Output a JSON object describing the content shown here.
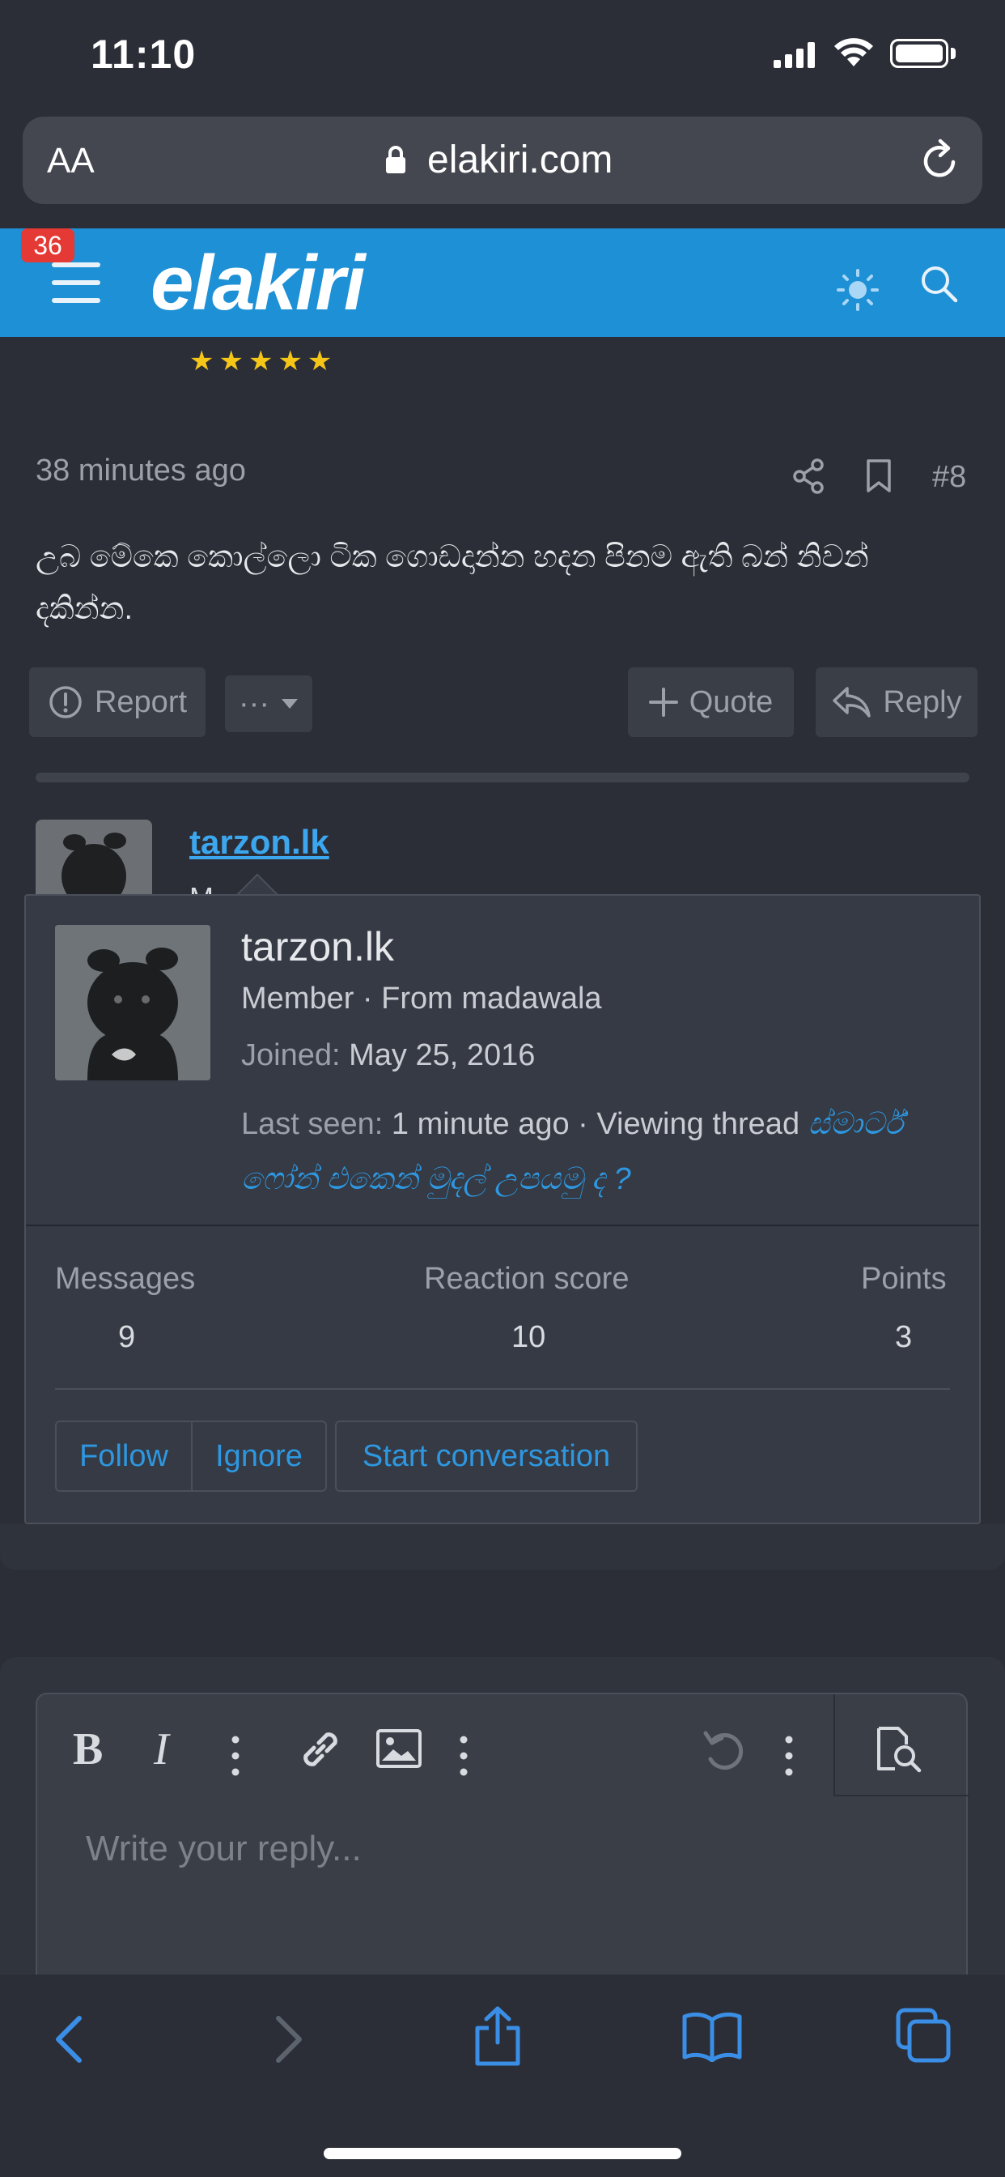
{
  "status_bar": {
    "time": "11:10"
  },
  "browser": {
    "text_size_label": "AA",
    "url": "elakiri.com"
  },
  "header": {
    "notification_count": "36",
    "logo_text": "elakiri"
  },
  "post": {
    "time": "38 minutes ago",
    "number": "#8",
    "body": "උබ මේකෙ කොල්ලො ටික ගොඩදාන්න හදන පිනම ඇති බන් නිවන් දකින්න.",
    "actions": {
      "report": "Report",
      "more": "···",
      "quote": "Quote",
      "reply": "Reply"
    }
  },
  "next_post": {
    "username": "tarzon.lk",
    "subtitle": "M"
  },
  "member_card": {
    "name": "tarzon.lk",
    "role": "Member · From madawala",
    "joined_label": "Joined:",
    "joined_value": "May 25, 2016",
    "last_seen_label": "Last seen:",
    "last_seen_value": "1 minute ago · Viewing thread",
    "thread_title": "ස්මාර්ට් ෆෝන් එකෙන් මුදල් උපයමු ද ?",
    "stats": [
      {
        "label": "Messages",
        "value": "9"
      },
      {
        "label": "Reaction score",
        "value": "10"
      },
      {
        "label": "Points",
        "value": "3"
      }
    ],
    "buttons": {
      "follow": "Follow",
      "ignore": "Ignore",
      "start_conversation": "Start conversation"
    }
  },
  "editor": {
    "placeholder": "Write your reply..."
  },
  "icons": {
    "share": "share-icon",
    "bookmark": "bookmark-icon",
    "search": "search-icon",
    "theme": "sun-icon"
  },
  "colors": {
    "brand_blue": "#1e90d6",
    "link_blue": "#2e97e0",
    "badge_red": "#e53935",
    "star_gold": "#f5c518"
  }
}
